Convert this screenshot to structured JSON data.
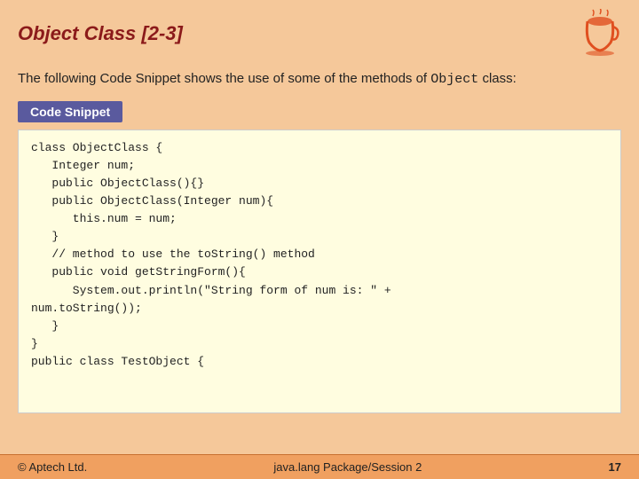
{
  "header": {
    "title": "Object Class [2-3]"
  },
  "intro": {
    "text": "The following Code Snippet shows the use of some of the methods of ",
    "code": "Object",
    "text2": " class:"
  },
  "snippet_label": "Code Snippet",
  "code": {
    "lines": [
      "class ObjectClass {",
      "   Integer num;",
      "   public ObjectClass(){}",
      "   public ObjectClass(Integer num){",
      "      this.num = num;",
      "   }",
      "   // method to use the toString() method",
      "   public void getStringForm(){",
      "      System.out.println(\"String form of num is: \" +",
      "num.toString());",
      "   }",
      "}",
      "public class TestObject {"
    ]
  },
  "footer": {
    "left": "© Aptech Ltd.",
    "center": "java.lang Package/Session 2",
    "right": "17"
  }
}
